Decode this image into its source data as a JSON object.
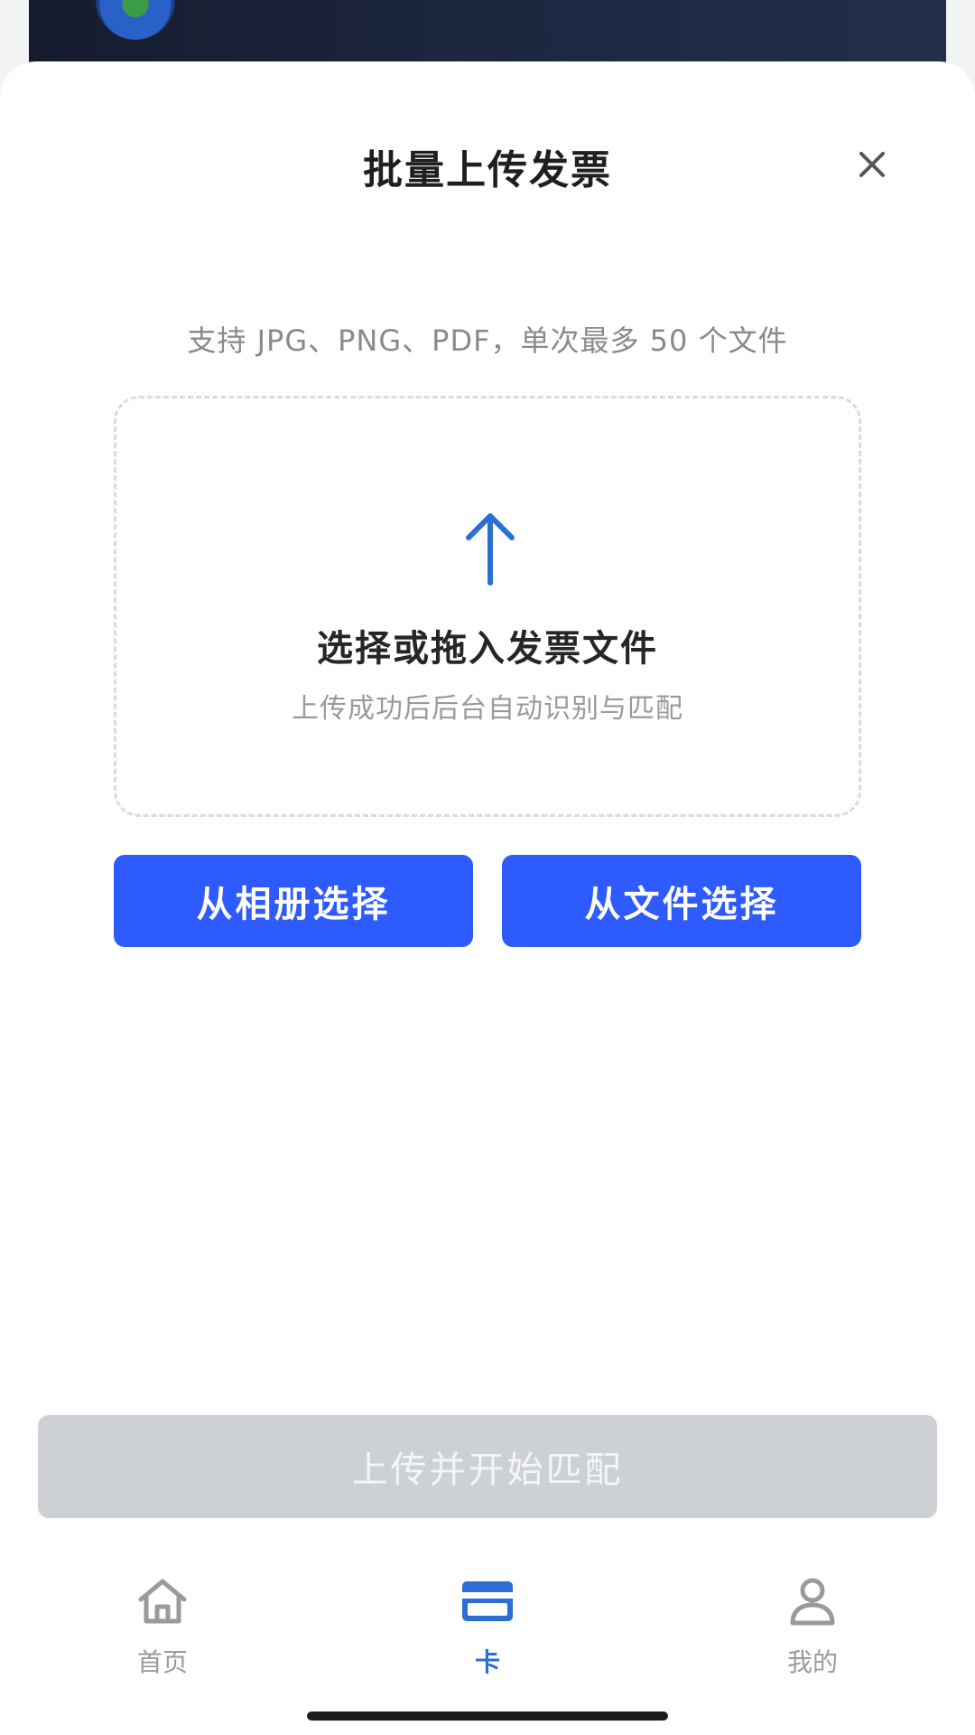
{
  "sheet": {
    "title": "批量上传发票",
    "hint": "支持 JPG、PNG、PDF，单次最多 50 个文件"
  },
  "dropzone": {
    "title": "选择或拖入发票文件",
    "subtitle": "上传成功后后台自动识别与匹配",
    "icon": "upload-arrow-icon"
  },
  "actions": {
    "album_label": "从相册选择",
    "file_label": "从文件选择",
    "submit_label": "上传并开始匹配",
    "submit_enabled": false
  },
  "tabs": [
    {
      "label": "首页",
      "icon": "home-icon",
      "active": false
    },
    {
      "label": "卡",
      "icon": "card-icon",
      "active": true
    },
    {
      "label": "我的",
      "icon": "user-icon",
      "active": false
    }
  ],
  "colors": {
    "primary": "#2e5bff",
    "tab_active": "#2b6fd6",
    "tab_inactive": "#9a9a9a",
    "disabled": "#cdd1d6"
  }
}
